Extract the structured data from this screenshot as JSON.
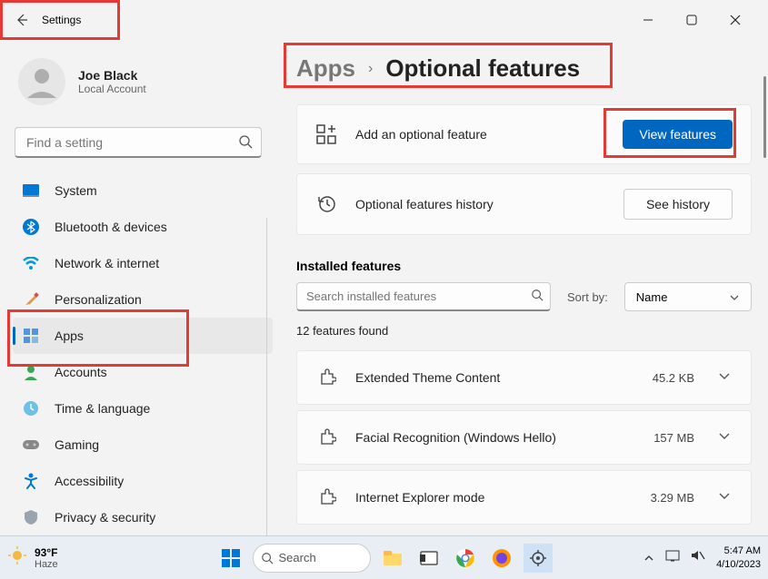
{
  "titlebar": {
    "title": "Settings"
  },
  "profile": {
    "name": "Joe Black",
    "subtitle": "Local Account"
  },
  "search": {
    "placeholder": "Find a setting"
  },
  "nav": {
    "items": [
      {
        "label": "System"
      },
      {
        "label": "Bluetooth & devices"
      },
      {
        "label": "Network & internet"
      },
      {
        "label": "Personalization"
      },
      {
        "label": "Apps"
      },
      {
        "label": "Accounts"
      },
      {
        "label": "Time & language"
      },
      {
        "label": "Gaming"
      },
      {
        "label": "Accessibility"
      },
      {
        "label": "Privacy & security"
      }
    ]
  },
  "breadcrumb": {
    "parent": "Apps",
    "current": "Optional features"
  },
  "cards": {
    "add": {
      "label": "Add an optional feature",
      "button": "View features"
    },
    "history": {
      "label": "Optional features history",
      "button": "See history"
    }
  },
  "installed": {
    "title": "Installed features",
    "search_placeholder": "Search installed features",
    "sort_label": "Sort by:",
    "sort_value": "Name",
    "count": "12 features found",
    "items": [
      {
        "name": "Extended Theme Content",
        "size": "45.2 KB"
      },
      {
        "name": "Facial Recognition (Windows Hello)",
        "size": "157 MB"
      },
      {
        "name": "Internet Explorer mode",
        "size": "3.29 MB"
      }
    ]
  },
  "taskbar": {
    "temp": "93°F",
    "condition": "Haze",
    "search": "Search",
    "time": "5:47 AM",
    "date": "4/10/2023"
  }
}
